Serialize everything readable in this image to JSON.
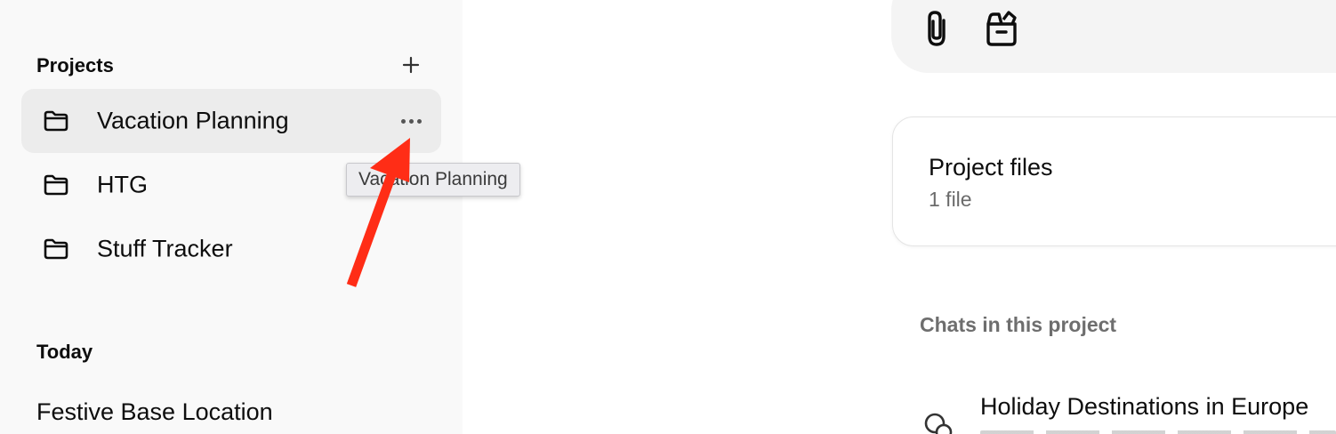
{
  "sidebar": {
    "projects_header": "Projects",
    "projects": [
      {
        "label": "Vacation Planning",
        "active": true
      },
      {
        "label": "HTG",
        "active": false
      },
      {
        "label": "Stuff Tracker",
        "active": false
      }
    ],
    "today_header": "Today",
    "chats": [
      {
        "label": "Festive Base Location"
      }
    ]
  },
  "tooltip": {
    "text": "Vacation Planning"
  },
  "main": {
    "composer_icons": [
      "paperclip-icon",
      "toolbox-icon"
    ],
    "files_card": {
      "title": "Project files",
      "count": "1 file"
    },
    "chats_header": "Chats in this project",
    "chats": [
      {
        "title": "Holiday Destinations in Europe"
      }
    ]
  },
  "colors": {
    "annotation_arrow": "#ff2d16",
    "sidebar_bg": "#f9f9f9",
    "active_item_bg": "#ececec"
  }
}
